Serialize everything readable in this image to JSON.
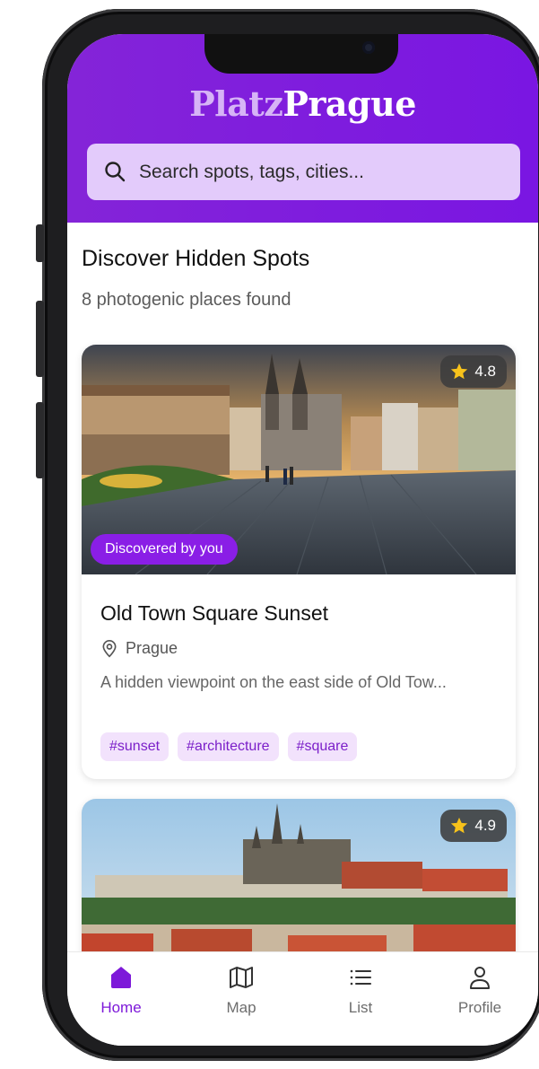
{
  "app": {
    "brand_part1": "Platz",
    "brand_part2": "Prague"
  },
  "search": {
    "placeholder": "Search spots, tags, cities...",
    "value": ""
  },
  "discover": {
    "title": "Discover Hidden Spots",
    "subtitle": "8 photogenic places found"
  },
  "cards": [
    {
      "rating": "4.8",
      "badge": "Discovered by you",
      "title": "Old Town Square Sunset",
      "location": "Prague",
      "description": "A hidden viewpoint on the east side of Old Tow...",
      "tags": [
        "#sunset",
        "#architecture",
        "#square"
      ]
    },
    {
      "rating": "4.9"
    }
  ],
  "nav": {
    "items": [
      {
        "label": "Home",
        "icon": "home-icon",
        "active": true
      },
      {
        "label": "Map",
        "icon": "map-icon",
        "active": false
      },
      {
        "label": "List",
        "icon": "list-icon",
        "active": false
      },
      {
        "label": "Profile",
        "icon": "profile-icon",
        "active": false
      }
    ]
  },
  "colors": {
    "brand": "#7a16e2",
    "brand_light": "#d6b4f6",
    "search_bg": "#e3cbfb",
    "tag_bg": "#f2e2fc",
    "tag_text": "#7b1fc9",
    "active_nav": "#7d19d9",
    "star": "#f7c21b"
  }
}
